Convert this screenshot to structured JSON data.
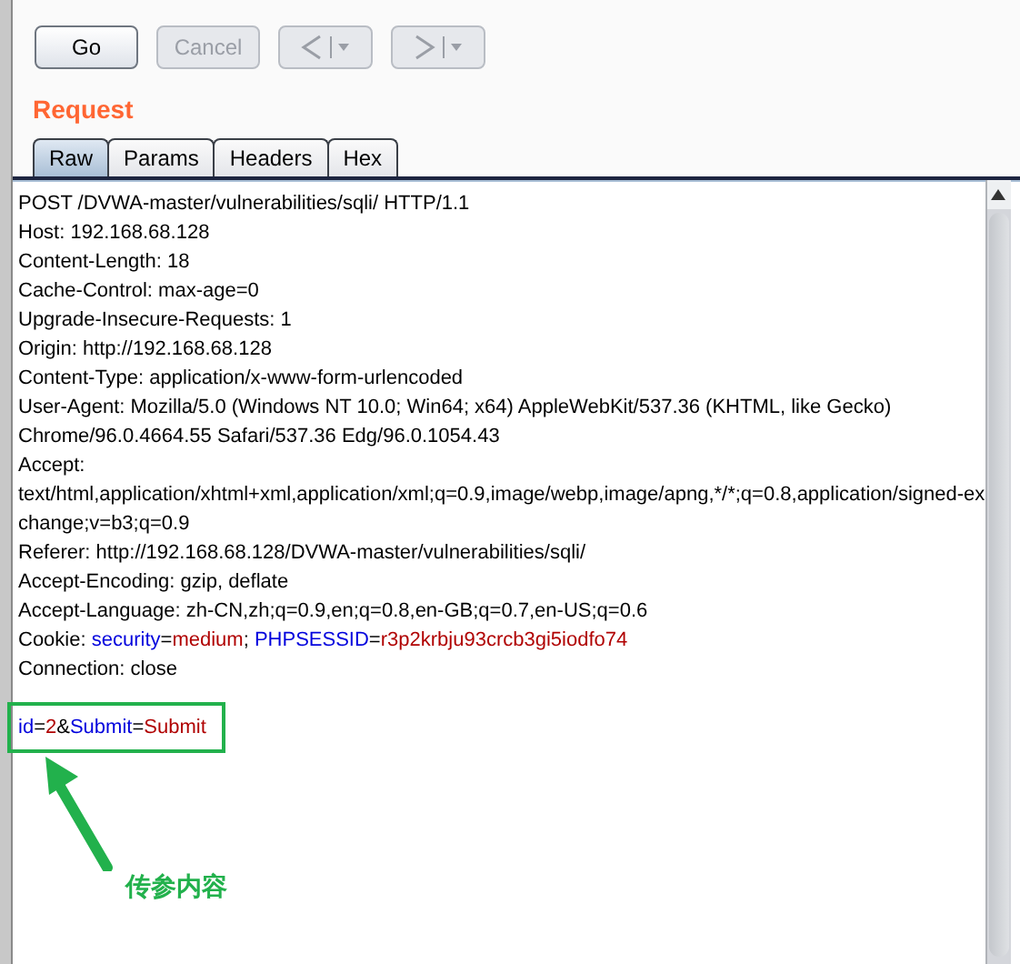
{
  "toolbar": {
    "buttons": [
      {
        "kind": "text",
        "label": "Go",
        "disabled": false
      },
      {
        "kind": "text",
        "label": "Cancel",
        "disabled": true
      },
      {
        "kind": "back",
        "disabled": true
      },
      {
        "kind": "forward",
        "disabled": true
      }
    ]
  },
  "section_title": "Request",
  "tabs": [
    {
      "label": "Raw",
      "selected": true
    },
    {
      "label": "Params",
      "selected": false
    },
    {
      "label": "Headers",
      "selected": false
    },
    {
      "label": "Hex",
      "selected": false
    }
  ],
  "request_lines": [
    {
      "segments": [
        {
          "kind": "plain",
          "text": "POST /DVWA-master/vulnerabilities/sqli/ HTTP/1.1"
        }
      ]
    },
    {
      "segments": [
        {
          "kind": "plain",
          "text": "Host: 192.168.68.128"
        }
      ]
    },
    {
      "segments": [
        {
          "kind": "plain",
          "text": "Content-Length: 18"
        }
      ]
    },
    {
      "segments": [
        {
          "kind": "plain",
          "text": "Cache-Control: max-age=0"
        }
      ]
    },
    {
      "segments": [
        {
          "kind": "plain",
          "text": "Upgrade-Insecure-Requests: 1"
        }
      ]
    },
    {
      "segments": [
        {
          "kind": "plain",
          "text": "Origin: http://192.168.68.128"
        }
      ]
    },
    {
      "segments": [
        {
          "kind": "plain",
          "text": "Content-Type: application/x-www-form-urlencoded"
        }
      ]
    },
    {
      "segments": [
        {
          "kind": "plain",
          "text": "User-Agent: Mozilla/5.0 (Windows NT 10.0; Win64; x64) AppleWebKit/537.36 (KHTML, like Gecko)"
        }
      ]
    },
    {
      "segments": [
        {
          "kind": "plain",
          "text": "Chrome/96.0.4664.55 Safari/537.36 Edg/96.0.1054.43"
        }
      ]
    },
    {
      "segments": [
        {
          "kind": "plain",
          "text": "Accept:"
        }
      ]
    },
    {
      "segments": [
        {
          "kind": "plain",
          "text": "text/html,application/xhtml+xml,application/xml;q=0.9,image/webp,image/apng,*/*;q=0.8,application/signed-ex"
        }
      ]
    },
    {
      "segments": [
        {
          "kind": "plain",
          "text": "change;v=b3;q=0.9"
        }
      ]
    },
    {
      "segments": [
        {
          "kind": "plain",
          "text": "Referer: http://192.168.68.128/DVWA-master/vulnerabilities/sqli/"
        }
      ]
    },
    {
      "segments": [
        {
          "kind": "plain",
          "text": "Accept-Encoding: gzip, deflate"
        }
      ]
    },
    {
      "segments": [
        {
          "kind": "plain",
          "text": "Accept-Language: zh-CN,zh;q=0.9,en;q=0.8,en-GB;q=0.7,en-US;q=0.6"
        }
      ]
    },
    {
      "segments": [
        {
          "kind": "plain",
          "text": "Cookie: "
        },
        {
          "kind": "name",
          "text": "security"
        },
        {
          "kind": "plain",
          "text": "="
        },
        {
          "kind": "value",
          "text": "medium"
        },
        {
          "kind": "plain",
          "text": "; "
        },
        {
          "kind": "name",
          "text": "PHPSESSID"
        },
        {
          "kind": "plain",
          "text": "="
        },
        {
          "kind": "value",
          "text": "r3p2krbju93crcb3gi5iodfo74"
        }
      ]
    },
    {
      "segments": [
        {
          "kind": "plain",
          "text": "Connection: close"
        }
      ]
    }
  ],
  "request_body": {
    "segments": [
      {
        "kind": "name",
        "text": "id"
      },
      {
        "kind": "plain",
        "text": "="
      },
      {
        "kind": "value",
        "text": "2"
      },
      {
        "kind": "plain",
        "text": "&"
      },
      {
        "kind": "name",
        "text": "Submit"
      },
      {
        "kind": "plain",
        "text": "="
      },
      {
        "kind": "value",
        "text": "Submit"
      }
    ]
  },
  "annotation": {
    "label": "传参内容"
  }
}
